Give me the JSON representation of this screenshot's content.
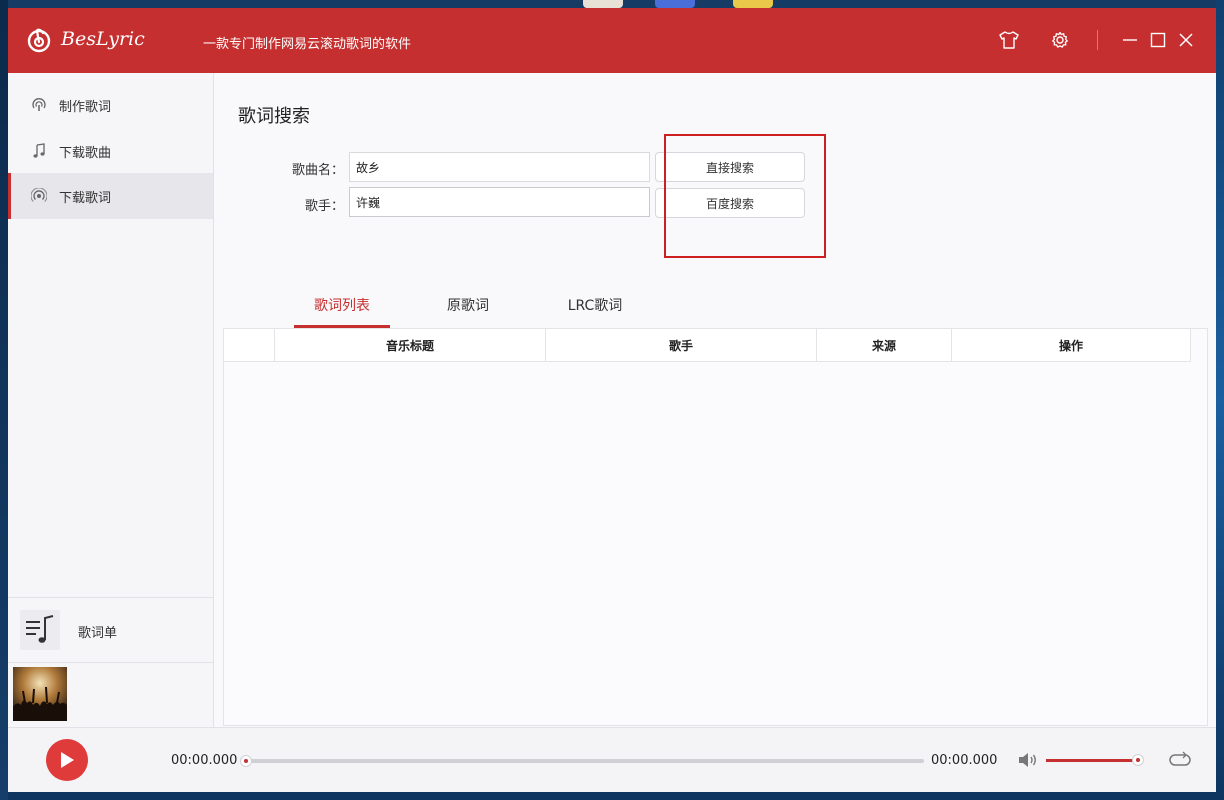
{
  "window": {
    "app_name": "BesLyric",
    "subtitle": "一款专门制作网易云滚动歌词的软件"
  },
  "titlebar": {
    "skin_icon": "tshirt-icon",
    "settings_icon": "gear-icon",
    "minimize_icon": "minimize-icon",
    "maximize_icon": "maximize-icon",
    "close_icon": "close-icon"
  },
  "sidebar": {
    "items": [
      {
        "label": "制作歌词",
        "icon": "podcast-icon",
        "active": false
      },
      {
        "label": "下载歌曲",
        "icon": "music-note-icon",
        "active": false
      },
      {
        "label": "下载歌词",
        "icon": "radio-icon",
        "active": true
      }
    ],
    "lyric_list_label": "歌词单"
  },
  "main": {
    "title": "歌词搜索",
    "song_label": "歌曲名：",
    "song_value": "故乡",
    "artist_label": "歌手：",
    "artist_value": "许巍",
    "direct_search_label": "直接搜索",
    "baidu_search_label": "百度搜索",
    "tabs": [
      {
        "label": "歌词列表",
        "active": true
      },
      {
        "label": "原歌词",
        "active": false
      },
      {
        "label": "LRC歌词",
        "active": false
      }
    ],
    "table": {
      "columns": [
        "音乐标题",
        "歌手",
        "来源",
        "操作"
      ],
      "rows": []
    }
  },
  "player": {
    "current_time": "00:00.000",
    "total_time": "00:00.000",
    "progress": 0,
    "volume": 0.95
  },
  "colors": {
    "accent": "#c62f2f",
    "play_button": "#e03b3b",
    "highlight_box": "#cc2020"
  }
}
